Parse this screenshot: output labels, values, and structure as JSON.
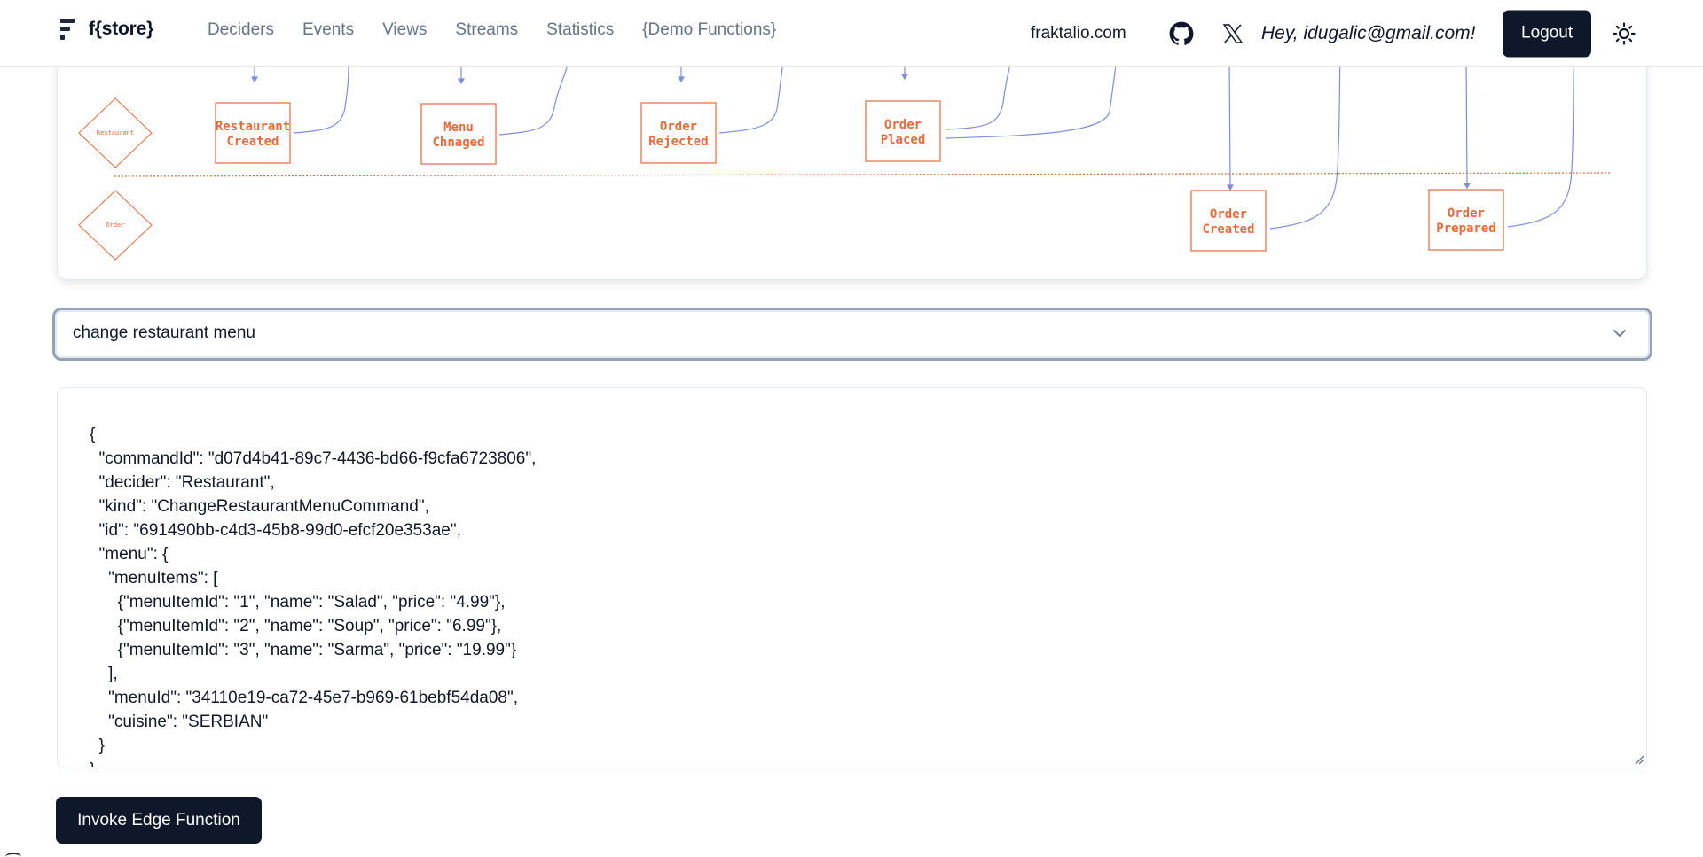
{
  "header": {
    "brand": "f{store}",
    "nav": [
      "Deciders",
      "Events",
      "Views",
      "Streams",
      "Statistics",
      "{Demo Functions}"
    ],
    "site_link": "fraktalio.com",
    "github_icon": "github-icon",
    "x_icon": "x-twitter-icon",
    "greeting": "Hey, idugalic@gmail.com!",
    "logout_label": "Logout",
    "theme_icon": "sun-icon"
  },
  "diagram": {
    "lanes": [
      "Restaurant",
      "Order"
    ],
    "events": [
      {
        "label_line1": "Restaurant",
        "label_line2": "Created",
        "lane": "Restaurant"
      },
      {
        "label_line1": "Menu",
        "label_line2": "Chnaged",
        "lane": "Restaurant"
      },
      {
        "label_line1": "Order",
        "label_line2": "Rejected",
        "lane": "Restaurant"
      },
      {
        "label_line1": "Order",
        "label_line2": "Placed",
        "lane": "Restaurant"
      },
      {
        "label_line1": "Order",
        "label_line2": "Created",
        "lane": "Order"
      },
      {
        "label_line1": "Order",
        "label_line2": "Prepared",
        "lane": "Order"
      }
    ],
    "colors": {
      "event": "#e8693a",
      "command": "#7b8fdc",
      "view": "#6b7280",
      "lane_divider": "#e8693a"
    }
  },
  "command_select": {
    "value": "change restaurant menu",
    "icon": "chevron-down-icon"
  },
  "editor": {
    "content": "{\n  \"commandId\": \"d07d4b41-89c7-4436-bd66-f9cfa6723806\",\n  \"decider\": \"Restaurant\",\n  \"kind\": \"ChangeRestaurantMenuCommand\",\n  \"id\": \"691490bb-c4d3-45b8-99d0-efcf20e353ae\",\n  \"menu\": {\n    \"menuItems\": [\n      {\"menuItemId\": \"1\", \"name\": \"Salad\", \"price\": \"4.99\"},\n      {\"menuItemId\": \"2\", \"name\": \"Soup\", \"price\": \"6.99\"},\n      {\"menuItemId\": \"3\", \"name\": \"Sarma\", \"price\": \"19.99\"}\n    ],\n    \"menuId\": \"34110e19-ca72-45e7-b969-61bebf54da08\",\n    \"cuisine\": \"SERBIAN\"\n  }\n}"
  },
  "actions": {
    "invoke_label": "Invoke Edge Function"
  },
  "colors": {
    "primary_button": "#0f172a",
    "nav_text": "#64748b"
  }
}
